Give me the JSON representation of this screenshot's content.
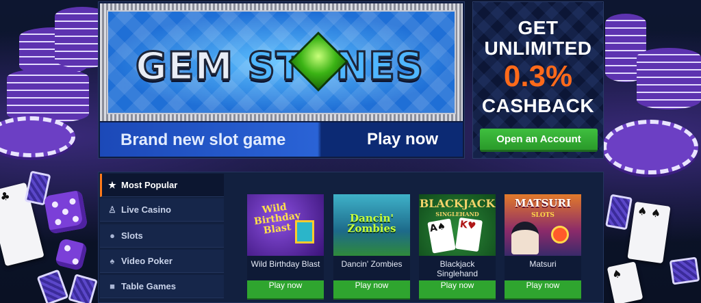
{
  "hero": {
    "logo_word1": "GEM",
    "logo_word2": "STONES",
    "subtitle": "Brand new slot game",
    "cta": "Play now"
  },
  "promo": {
    "line1": "GET",
    "line2": "UNLIMITED",
    "percent": "0.3%",
    "line3": "CASHBACK",
    "button": "Open an Account",
    "accent": "#ff6a1a"
  },
  "categories": [
    {
      "label": "Most Popular",
      "icon": "star-icon",
      "active": true
    },
    {
      "label": "Live Casino",
      "icon": "dealer-icon",
      "active": false
    },
    {
      "label": "Slots",
      "icon": "coins-icon",
      "active": false
    },
    {
      "label": "Video Poker",
      "icon": "spade-icon",
      "active": false
    },
    {
      "label": "Table Games",
      "icon": "dice-icon",
      "active": false
    }
  ],
  "games": [
    {
      "name": "Wild Birthday Blast",
      "thumb_text": "Wild Birthday Blast",
      "play": "Play now"
    },
    {
      "name": "Dancin' Zombies",
      "thumb_text": "Dancin' Zombies",
      "play": "Play now"
    },
    {
      "name": "Blackjack Singlehand",
      "thumb_text": "BLACKJACK",
      "thumb_sub": "SINGLEHAND",
      "play": "Play now"
    },
    {
      "name": "Matsuri",
      "thumb_text": "MATSURI",
      "thumb_sub": "SLOTS",
      "play": "Play now"
    }
  ]
}
